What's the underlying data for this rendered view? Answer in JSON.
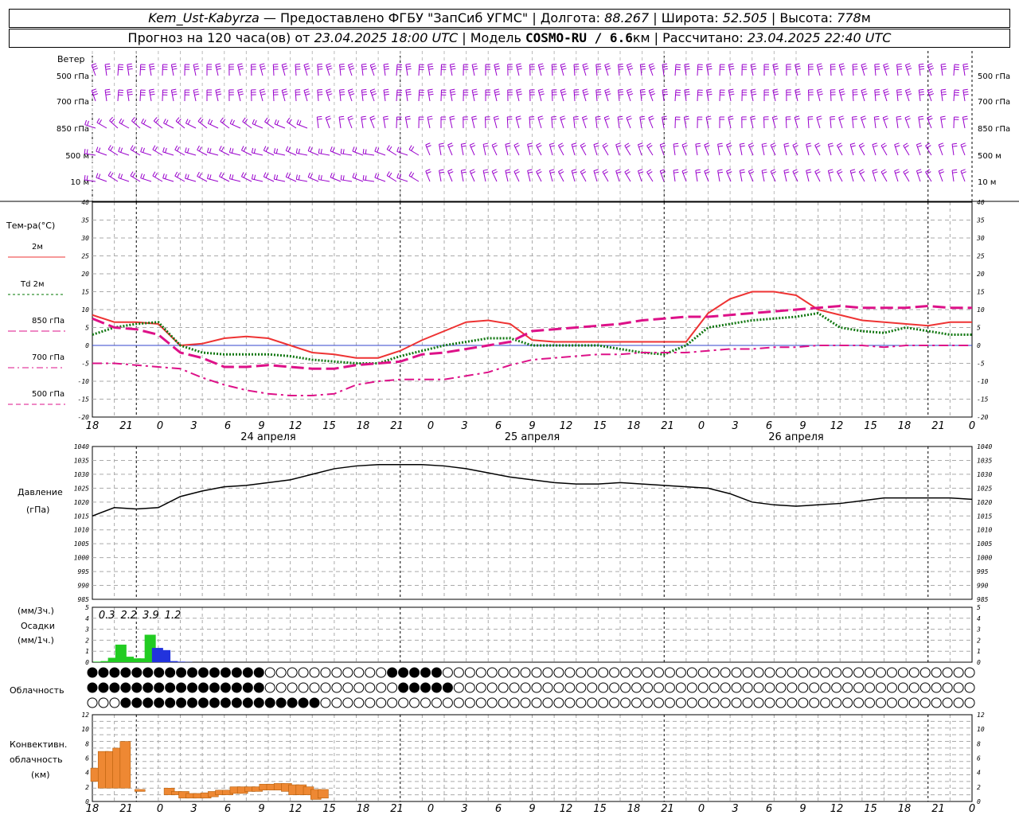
{
  "header": {
    "station": "Kem_Ust-Kabyrza",
    "provider": "Предоставлено ФГБУ \"ЗапСиб УГМС\"",
    "lon_label": "Долгота:",
    "lon_value": "88.267",
    "lat_label": "Широта:",
    "lat_value": "52.505",
    "alt_label": "Высота:",
    "alt_value": "778",
    "alt_unit": "м",
    "forecast_prefix": "Прогноз на 120 часа(ов) от",
    "forecast_time": "23.04.2025 18:00 UTC",
    "model_label": "Модель",
    "model_name": "COSMO-RU / 6.6",
    "model_unit": "км",
    "calc_label": "Рассчитано:",
    "calc_time": "23.04.2025 22:40 UTC"
  },
  "wind_panel": {
    "title": "Ветер",
    "levels": [
      "500 гПа",
      "700 гПа",
      "850 гПа",
      "500 м",
      "10  м"
    ],
    "color": "#9900cc"
  },
  "temp_panel": {
    "title": "Тем-ра(°C)",
    "legend": [
      {
        "label": "2м",
        "color": "#ee3333",
        "style": "solid"
      },
      {
        "label": "2м",
        "prefix": "Td",
        "color": "#007700",
        "style": "dotted"
      },
      {
        "label": "850 гПа",
        "color": "#dd1188",
        "style": "dash"
      },
      {
        "label": "700 гПа",
        "color": "#dd1188",
        "style": "dashdot"
      },
      {
        "label": "500 гПа",
        "color": "#dd1188",
        "style": "dash-short"
      }
    ],
    "ticks": [
      "40",
      "35",
      "30",
      "25",
      "20",
      "15",
      "10",
      "5",
      "0",
      "-5",
      "-10",
      "-15",
      "-20"
    ]
  },
  "x_axis": {
    "hours": [
      "18",
      "21",
      "0",
      "3",
      "6",
      "9",
      "12",
      "15",
      "18",
      "21",
      "0",
      "3",
      "6",
      "9",
      "12",
      "15",
      "18",
      "21",
      "0",
      "3",
      "6",
      "9",
      "12",
      "15",
      "18",
      "21",
      "0"
    ],
    "dates": [
      "24 апреля",
      "25 апреля",
      "26 апреля"
    ]
  },
  "pressure_panel": {
    "title_line1": "Давление",
    "title_line2": "(гПа)",
    "ticks": [
      "1040",
      "1035",
      "1030",
      "1025",
      "1020",
      "1015",
      "1010",
      "1005",
      "1000",
      "995",
      "990",
      "985"
    ]
  },
  "precip_panel": {
    "title_line1": "(мм/3ч.)",
    "title_line2": "Осадки",
    "title_line3": "(мм/1ч.)",
    "totals": [
      "0.3",
      "2.2",
      "3.9",
      "1.2"
    ],
    "ticks": [
      "5",
      "4",
      "3",
      "2",
      "1",
      "0"
    ]
  },
  "cloud_panel": {
    "title": "Облачность"
  },
  "conv_panel": {
    "title_line1": "Конвективн.",
    "title_line2": "облачность",
    "title_line3": "(км)",
    "ticks": [
      "12",
      "10",
      "8",
      "6",
      "4",
      "2",
      "0"
    ],
    "color": "#ee8833"
  },
  "chart_data": [
    {
      "type": "line",
      "id": "temperature",
      "x_hours": [
        0,
        3,
        6,
        9,
        12,
        15,
        18,
        21,
        24,
        27,
        30,
        33,
        36,
        39,
        42,
        45,
        48,
        51,
        54,
        57,
        60,
        63,
        66,
        69,
        72,
        75,
        78,
        81,
        84,
        87,
        90,
        93,
        96,
        99,
        102,
        105,
        108,
        111,
        114,
        117,
        120
      ],
      "ylim": [
        -20,
        40
      ],
      "series": [
        {
          "name": "2м",
          "values": [
            8.5,
            6.5,
            6.5,
            6,
            0,
            0.5,
            2,
            2.5,
            2,
            0,
            -2,
            -2.5,
            -3.5,
            -3.5,
            -1.5,
            1.5,
            4,
            6.5,
            7,
            6,
            1.5,
            1,
            1,
            1,
            1,
            1,
            1,
            1,
            9,
            13,
            15,
            15,
            14,
            10,
            8.5,
            7,
            6.5,
            6,
            5.5,
            6.5,
            6.5
          ]
        },
        {
          "name": "Td 2м",
          "values": [
            3,
            5,
            6,
            6.5,
            0,
            -2,
            -2.5,
            -2.5,
            -2.5,
            -3,
            -4,
            -4.5,
            -5,
            -5,
            -3,
            -1.5,
            0,
            1,
            2,
            2,
            0,
            0,
            0,
            0,
            -1,
            -2,
            -2.5,
            0,
            5,
            6,
            7,
            7.5,
            8,
            9,
            5,
            4,
            3.5,
            5,
            4,
            3,
            3
          ]
        },
        {
          "name": "850 гПа",
          "values": [
            7.5,
            5,
            4.5,
            3,
            -2,
            -3.5,
            -6,
            -6,
            -5.5,
            -6,
            -6.5,
            -6.5,
            -5.5,
            -5,
            -4.5,
            -2.5,
            -2,
            -1,
            0,
            1,
            4,
            4.5,
            5,
            5.5,
            6,
            7,
            7.5,
            8,
            8,
            8.5,
            9,
            9.5,
            10,
            10.5,
            11,
            10.5,
            10.5,
            10.5,
            11,
            10.5,
            10.5
          ]
        },
        {
          "name": "700 гПа",
          "values": [
            -5,
            -5,
            -5.5,
            -6,
            -6.5,
            -9,
            -11,
            -12.5,
            -13.5,
            -14,
            -14,
            -13.5,
            -11,
            -10,
            -9.5,
            -9.5,
            -9.5,
            -8.5,
            -7.5,
            -5.5,
            -4,
            -3.5,
            -3,
            -2.5,
            -2.5,
            -2,
            -2,
            -2,
            -1.5,
            -1,
            -1,
            -0.5,
            -0.5,
            0,
            0,
            0,
            -0.5,
            0,
            0,
            0,
            0
          ]
        }
      ]
    },
    {
      "type": "line",
      "id": "pressure",
      "x_hours": [
        0,
        3,
        6,
        9,
        12,
        15,
        18,
        21,
        24,
        27,
        30,
        33,
        36,
        39,
        42,
        45,
        48,
        51,
        54,
        57,
        60,
        63,
        66,
        69,
        72,
        75,
        78,
        81,
        84,
        87,
        90,
        93,
        96,
        99,
        102,
        105,
        108,
        111,
        114,
        117,
        120
      ],
      "ylim": [
        985,
        1040
      ],
      "series": [
        {
          "name": "Давление",
          "values": [
            1015,
            1018,
            1017.5,
            1018,
            1022,
            1024,
            1025.5,
            1026,
            1027,
            1028,
            1030,
            1032,
            1033,
            1033.5,
            1033.5,
            1033.5,
            1033,
            1032,
            1030.5,
            1029,
            1028,
            1027,
            1026.5,
            1026.5,
            1027,
            1026.5,
            1026,
            1025.5,
            1025,
            1023,
            1020,
            1019,
            1018.5,
            1019,
            1019.5,
            1020.5,
            1021.5,
            1021.5,
            1021.5,
            1021.5,
            1021
          ]
        }
      ]
    },
    {
      "type": "bar",
      "id": "precip_1h",
      "x_hours": [
        1,
        2,
        3,
        4,
        5,
        6,
        7,
        8,
        9,
        10,
        11,
        12,
        13
      ],
      "ylim": [
        0,
        5
      ],
      "series": [
        {
          "name": "мм/1ч",
          "values": [
            0.05,
            0.1,
            0.4,
            1.6,
            0.5,
            0.35,
            0.35,
            2.5,
            1.3,
            1.1,
            0.1,
            0.05,
            0.02
          ],
          "colors": [
            "#22cc22",
            "#22cc22",
            "#22cc22",
            "#22cc22",
            "#22cc22",
            "#22cc22",
            "#22cc22",
            "#22cc22",
            "#2233dd",
            "#2233dd",
            "#2233dd",
            "#2233dd",
            "#2233dd"
          ]
        }
      ]
    },
    {
      "type": "bar",
      "id": "convective",
      "x_hours": [
        0,
        1,
        2,
        3,
        4,
        5,
        6,
        7,
        8,
        9,
        10,
        11,
        12,
        13,
        14,
        15,
        16,
        17,
        18,
        19,
        20,
        21,
        22,
        23,
        24,
        25,
        26,
        27,
        28,
        29,
        30,
        31
      ],
      "ylim": [
        0,
        13
      ],
      "series": [
        {
          "name": "Конвективн.",
          "bottoms": [
            3,
            2,
            2,
            2,
            2,
            2,
            1.5,
            1.5,
            0,
            0,
            1,
            1,
            0.5,
            0.5,
            0.5,
            0.5,
            0.7,
            1,
            1,
            1.2,
            1.2,
            1.5,
            1.5,
            1.7,
            1.7,
            1.7,
            1.5,
            1,
            1,
            1,
            0.3,
            0.5
          ],
          "tops": [
            5,
            7.5,
            7.5,
            8,
            9,
            2,
            1.8,
            1.5,
            0,
            0,
            2,
            1.5,
            1.5,
            1.2,
            1.2,
            1.3,
            1.5,
            1.7,
            1.7,
            2.2,
            2.2,
            2.2,
            2.2,
            2.6,
            2.6,
            2.7,
            2.7,
            2.5,
            2.5,
            2.2,
            1.8,
            1.8
          ]
        }
      ]
    }
  ]
}
